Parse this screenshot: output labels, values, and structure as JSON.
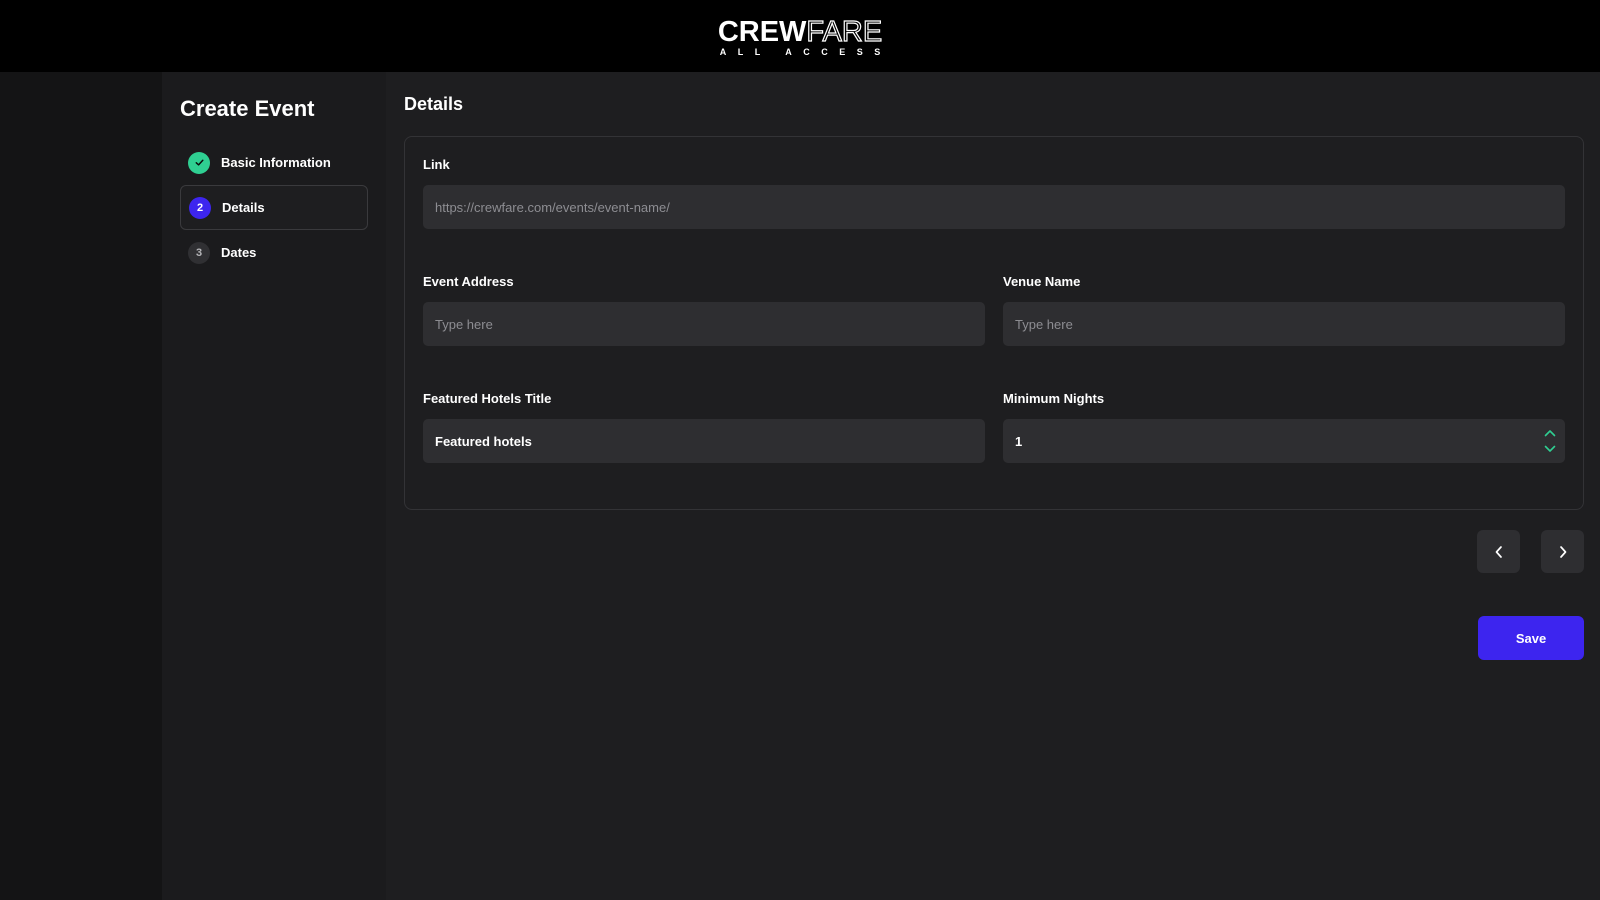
{
  "header": {
    "logo_bold": "CREW",
    "logo_outline": "FARE",
    "logo_sub": "ALL ACCESS"
  },
  "sidebar": {
    "title": "Create Event",
    "steps": [
      {
        "number": "✓",
        "label": "Basic Information",
        "status": "completed"
      },
      {
        "number": "2",
        "label": "Details",
        "status": "active"
      },
      {
        "number": "3",
        "label": "Dates",
        "status": "pending"
      }
    ]
  },
  "main": {
    "title": "Details",
    "form": {
      "link": {
        "label": "Link",
        "value": "",
        "placeholder": "https://crewfare.com/events/event-name/"
      },
      "event_address": {
        "label": "Event Address",
        "value": "",
        "placeholder": "Type here"
      },
      "venue_name": {
        "label": "Venue Name",
        "value": "",
        "placeholder": "Type here"
      },
      "featured_hotels_title": {
        "label": "Featured Hotels Title",
        "value": "Featured hotels",
        "placeholder": ""
      },
      "minimum_nights": {
        "label": "Minimum Nights",
        "value": "1",
        "placeholder": ""
      }
    },
    "save_label": "Save"
  },
  "colors": {
    "accent": "#3d25ef",
    "success": "#2fcf92",
    "stepper_arrows": "#2fcf92"
  }
}
